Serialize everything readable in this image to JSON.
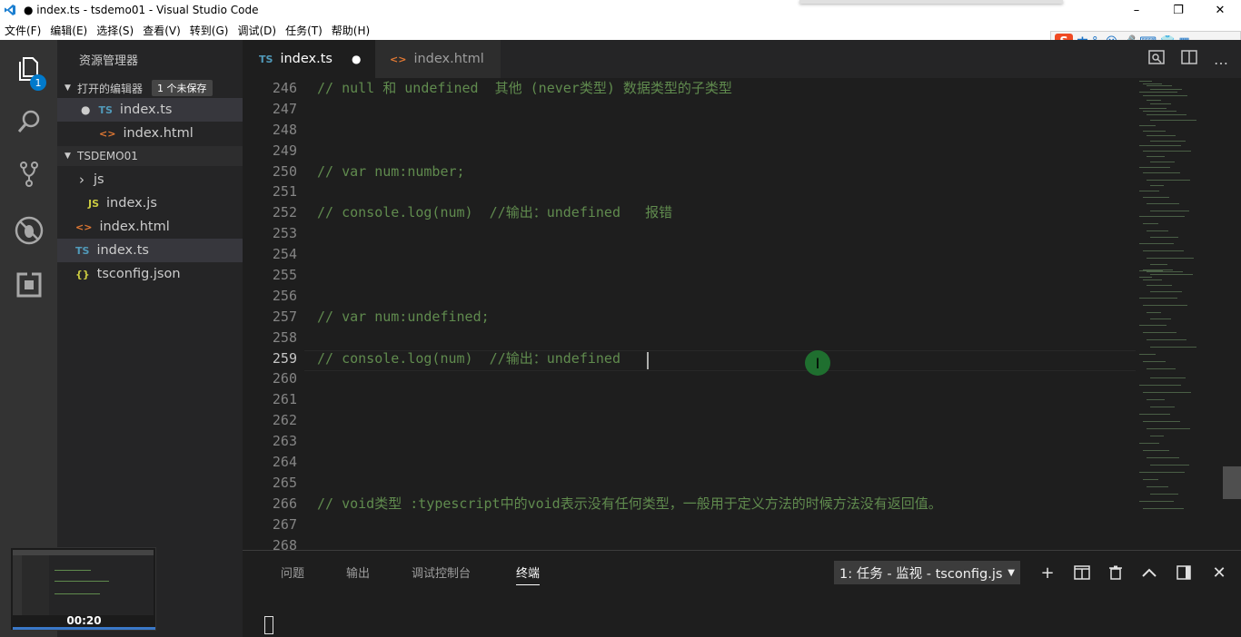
{
  "window": {
    "title": "● index.ts - tsdemo01 - Visual Studio Code",
    "controls": [
      "–",
      "❐",
      "✕"
    ]
  },
  "menu": [
    "文件(F)",
    "编辑(E)",
    "选择(S)",
    "查看(V)",
    "转到(G)",
    "调试(D)",
    "任务(T)",
    "帮助(H)"
  ],
  "ime": {
    "logo": "S",
    "mode": "中",
    "punct": "°,"
  },
  "activity": {
    "badge": "1",
    "icons": [
      "explorer-icon",
      "search-icon",
      "source-control-icon",
      "debug-icon",
      "extensions-icon"
    ]
  },
  "sidebar": {
    "title": "资源管理器",
    "open_editors": {
      "label": "打开的编辑器",
      "unsaved_badge": "1 个未保存",
      "items": [
        {
          "icon": "TS",
          "label": "index.ts",
          "dirty": "●"
        },
        {
          "icon": "<>",
          "label": "index.html"
        }
      ]
    },
    "project": {
      "label": "TSDEMO01",
      "items": [
        {
          "icon": "›",
          "label": "js"
        },
        {
          "icon": "JS",
          "label": "index.js"
        },
        {
          "icon": "<>",
          "label": "index.html"
        },
        {
          "icon": "TS",
          "label": "index.ts"
        },
        {
          "icon": "{}",
          "label": "tsconfig.json"
        }
      ]
    }
  },
  "tabs": [
    {
      "icon": "TS",
      "label": "index.ts",
      "dirty": "●"
    },
    {
      "icon": "<>",
      "label": "index.html"
    }
  ],
  "tab_actions": [
    "…"
  ],
  "editor": {
    "current_line": "259",
    "lines": [
      {
        "n": "246",
        "text": "// null 和 undefined  其他 (never类型) 数据类型的子类型"
      },
      {
        "n": "247",
        "text": ""
      },
      {
        "n": "248",
        "text": ""
      },
      {
        "n": "249",
        "text": ""
      },
      {
        "n": "250",
        "text": "// var num:number;"
      },
      {
        "n": "251",
        "text": ""
      },
      {
        "n": "252",
        "text": "// console.log(num)  //输出：undefined   报错"
      },
      {
        "n": "253",
        "text": ""
      },
      {
        "n": "254",
        "text": ""
      },
      {
        "n": "255",
        "text": ""
      },
      {
        "n": "256",
        "text": ""
      },
      {
        "n": "257",
        "text": "// var num:undefined;"
      },
      {
        "n": "258",
        "text": ""
      },
      {
        "n": "259",
        "text": "// console.log(num)  //输出：undefined"
      },
      {
        "n": "260",
        "text": ""
      },
      {
        "n": "261",
        "text": ""
      },
      {
        "n": "262",
        "text": ""
      },
      {
        "n": "263",
        "text": ""
      },
      {
        "n": "264",
        "text": ""
      },
      {
        "n": "265",
        "text": ""
      },
      {
        "n": "266",
        "text": "// void类型 :typescript中的void表示没有任何类型，一般用于定义方法的时候方法没有返回值。"
      },
      {
        "n": "267",
        "text": ""
      },
      {
        "n": "268",
        "text": ""
      }
    ]
  },
  "panel": {
    "tabs": [
      "问题",
      "输出",
      "调试控制台",
      "终端"
    ],
    "active_tab": "终端",
    "task_select": "1: 任务 - 监视 - tsconfig.js",
    "actions": [
      "+",
      "⊟",
      "🗑",
      "∧",
      "◫",
      "✕"
    ]
  },
  "thumbnail": {
    "time": "00:20"
  },
  "colors": {
    "comment": "#608b4e",
    "accent": "#007acc",
    "ts_icon": "#519aba",
    "html_icon": "#e37933",
    "js_icon": "#cbcb41"
  }
}
